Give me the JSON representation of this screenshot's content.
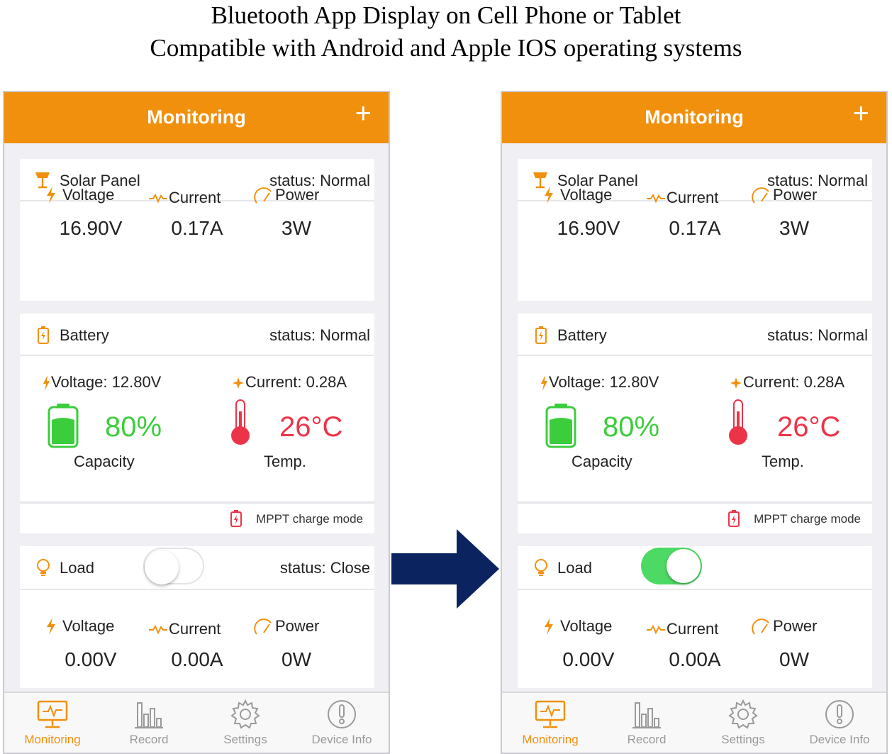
{
  "caption": {
    "line1": "Bluetooth App Display on Cell Phone or Tablet",
    "line2": "Compatible with Android and Apple IOS operating systems"
  },
  "colors": {
    "accent": "#f1900d",
    "battery_green": "#3ccd3c",
    "temp_red": "#ec3448",
    "toggle_on": "#4cd964",
    "arrow": "#0b2460"
  },
  "phone_left": {
    "header": {
      "title": "Monitoring",
      "add_icon": "+"
    },
    "solar": {
      "label": "Solar Panel",
      "status": "status: Normal",
      "voltage_label": "Voltage",
      "voltage_value": "16.90V",
      "current_label": "Current",
      "current_value": "0.17A",
      "power_label": "Power",
      "power_value": "3W"
    },
    "battery": {
      "label": "Battery",
      "status": "status: Normal",
      "voltage_text": "Voltage: 12.80V",
      "current_text": "Current: 0.28A",
      "capacity_value": "80%",
      "capacity_label": "Capacity",
      "temp_value": "26°C",
      "temp_label": "Temp.",
      "charge_mode": "MPPT charge mode"
    },
    "load": {
      "label": "Load",
      "toggle_on": false,
      "status": "status: Close",
      "voltage_label": "Voltage",
      "voltage_value": "0.00V",
      "current_label": "Current",
      "current_value": "0.00A",
      "power_label": "Power",
      "power_value": "0W"
    },
    "tabs": [
      "Monitoring",
      "Record",
      "Settings",
      "Device Info"
    ]
  },
  "phone_right": {
    "header": {
      "title": "Monitoring",
      "add_icon": "+"
    },
    "solar": {
      "label": "Solar Panel",
      "status": "status: Normal",
      "voltage_label": "Voltage",
      "voltage_value": "16.90V",
      "current_label": "Current",
      "current_value": "0.17A",
      "power_label": "Power",
      "power_value": "3W"
    },
    "battery": {
      "label": "Battery",
      "status": "status: Normal",
      "voltage_text": "Voltage: 12.80V",
      "current_text": "Current: 0.28A",
      "capacity_value": "80%",
      "capacity_label": "Capacity",
      "temp_value": "26°C",
      "temp_label": "Temp.",
      "charge_mode": "MPPT charge mode"
    },
    "load": {
      "label": "Load",
      "toggle_on": true,
      "voltage_label": "Voltage",
      "voltage_value": "0.00V",
      "current_label": "Current",
      "current_value": "0.00A",
      "power_label": "Power",
      "power_value": "0W"
    },
    "tabs": [
      "Monitoring",
      "Record",
      "Settings",
      "Device Info"
    ]
  }
}
